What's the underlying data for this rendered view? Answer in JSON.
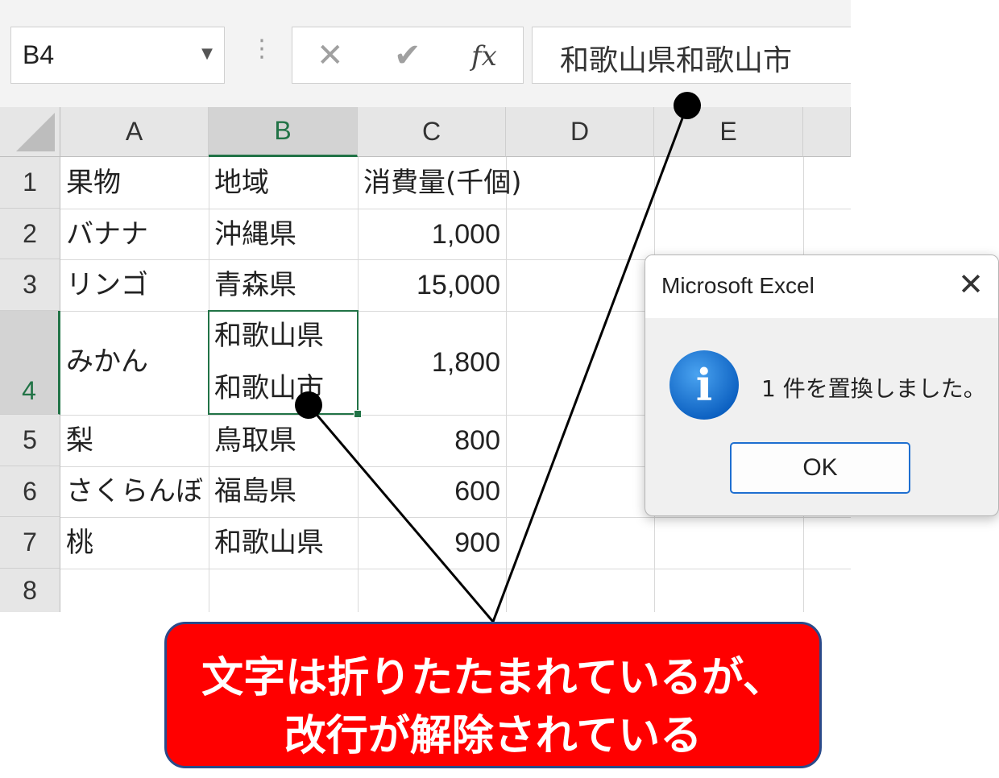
{
  "namebox": {
    "value": "B4"
  },
  "formula_bar": {
    "content": "和歌山県和歌山市",
    "cancel_glyph": "✕",
    "enter_glyph": "✔",
    "fx_glyph": "fx"
  },
  "columns": [
    "A",
    "B",
    "C",
    "D",
    "E"
  ],
  "rows": [
    "1",
    "2",
    "3",
    "4",
    "5",
    "6",
    "7",
    "8"
  ],
  "cells": {
    "r1": {
      "a": "果物",
      "b": "地域",
      "c": "消費量(千個)"
    },
    "r2": {
      "a": "バナナ",
      "b": "沖縄県",
      "c": "1,000"
    },
    "r3": {
      "a": "リンゴ",
      "b": "青森県",
      "c": "15,000"
    },
    "r4": {
      "a": "みかん",
      "b_line1": "和歌山県",
      "b_line2": "和歌山市",
      "c": "1,800"
    },
    "r5": {
      "a": "梨",
      "b": "鳥取県",
      "c": "800"
    },
    "r6": {
      "a": "さくらんぼ",
      "b": "福島県",
      "c": "600"
    },
    "r7": {
      "a": "桃",
      "b": "和歌山県",
      "c": "900"
    }
  },
  "dialog": {
    "title": "Microsoft Excel",
    "close_glyph": "✕",
    "icon": "info-icon",
    "message": "1 件を置換しました。",
    "ok_label": "OK"
  },
  "callout": {
    "line1": "文字は折りたたまれているが、",
    "line2": "改行が解除されている"
  },
  "colors": {
    "accent_green": "#217346",
    "callout_red": "#ff0000",
    "dialog_button_blue": "#1e6fd0"
  }
}
